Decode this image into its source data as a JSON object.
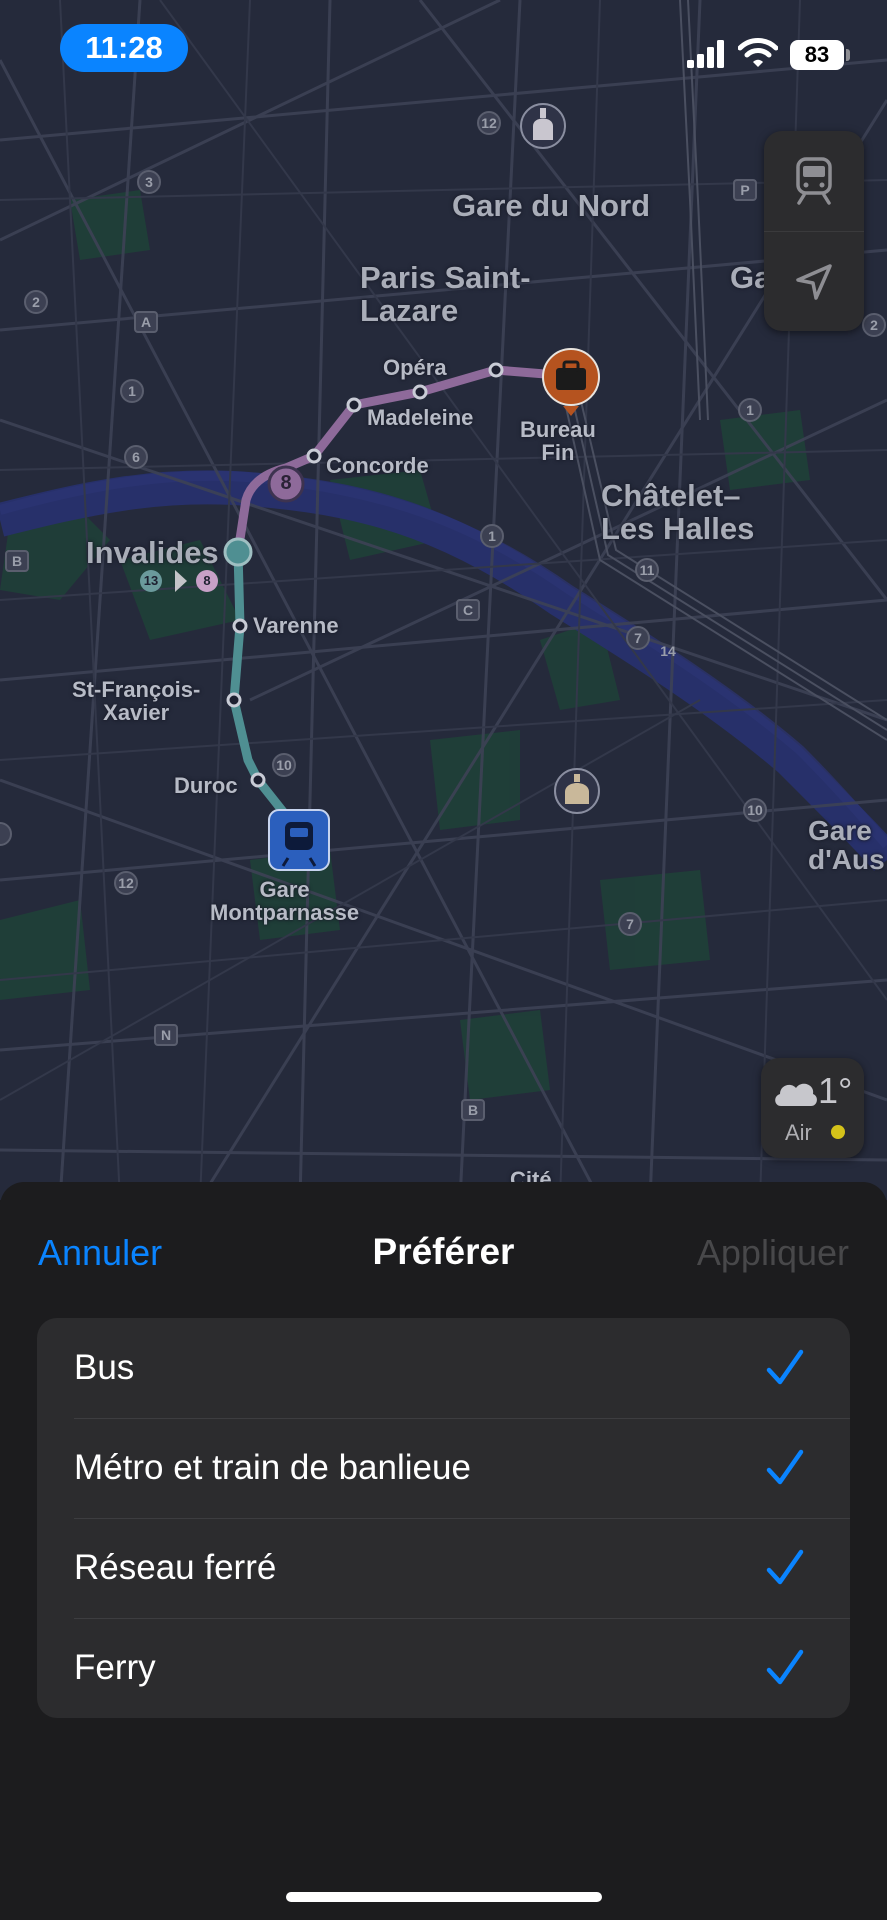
{
  "status_bar": {
    "time": "11:28",
    "battery": "83"
  },
  "map": {
    "labels": {
      "gare_du_nord": "Gare du Nord",
      "paris_saint_lazare": "Paris Saint-\nLazare",
      "opera": "Opéra",
      "madeleine": "Madeleine",
      "concorde": "Concorde",
      "bureau_fin": "Bureau\nFin",
      "chatelet": "Châtelet–\nLes Halles",
      "invalides": "Invalides",
      "varenne": "Varenne",
      "st_francois_xavier": "St-François-\nXavier",
      "duroc": "Duroc",
      "gare_montparnasse": "Gare\nMontparnasse",
      "gare_austerlitz": "Gare\nd'Aus",
      "gare_partial": "Ga",
      "cite": "Cité"
    },
    "line_badges": [
      "13",
      "8"
    ],
    "route_badge": "8"
  },
  "weather": {
    "temperature": "1°",
    "air_label": "Air"
  },
  "sheet": {
    "cancel_label": "Annuler",
    "title": "Préférer",
    "apply_label": "Appliquer",
    "options": [
      {
        "label": "Bus",
        "checked": true
      },
      {
        "label": "Métro et train de banlieue",
        "checked": true
      },
      {
        "label": "Réseau ferré",
        "checked": true
      },
      {
        "label": "Ferry",
        "checked": true
      }
    ]
  },
  "colors": {
    "accent": "#0a84ff",
    "route_purple": "#8e6a9a",
    "route_teal": "#4f8f92",
    "sheet_bg": "#1c1c1e",
    "cell_bg": "#2c2c2e"
  }
}
